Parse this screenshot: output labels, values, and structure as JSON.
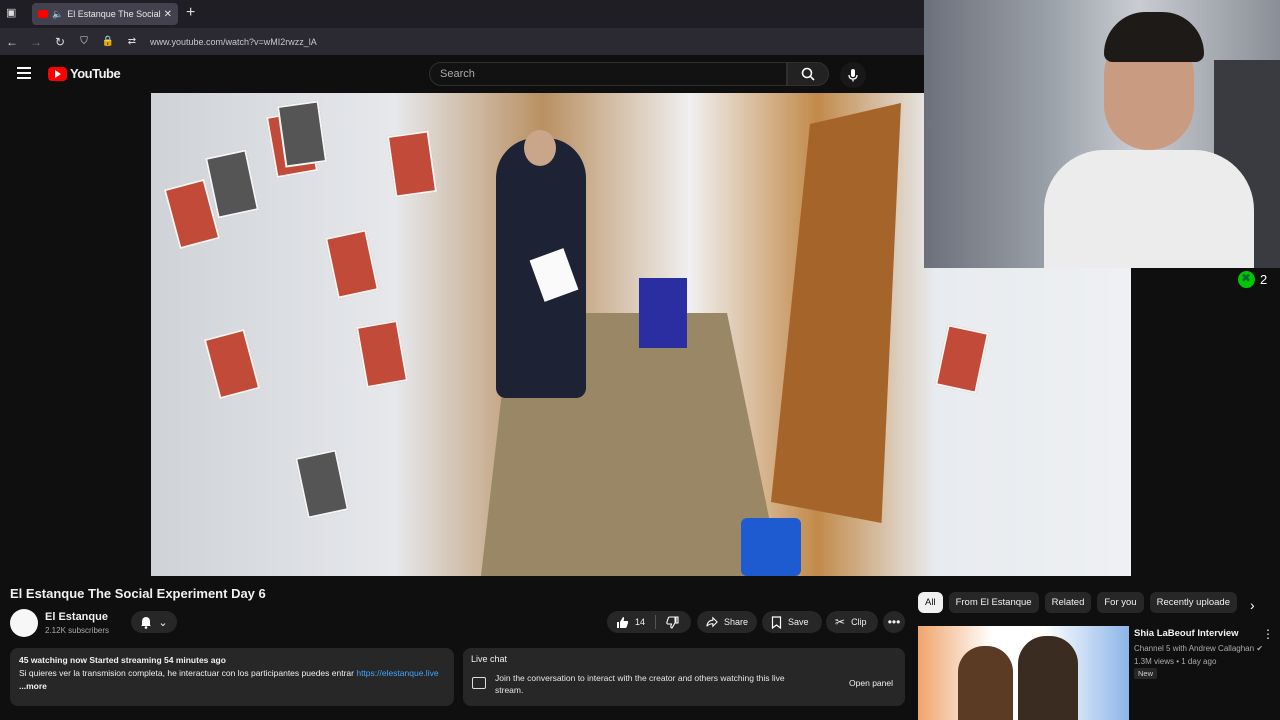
{
  "browser": {
    "tab_title": "El Estanque The Social Experi",
    "url": "www.youtube.com/watch?v=wMI2rwzz_lA"
  },
  "header": {
    "logo_text": "YouTube",
    "search_placeholder": "Search"
  },
  "stream": {
    "viewer_count": "2"
  },
  "video": {
    "title": "El Estanque The Social Experiment Day 6",
    "channel_name": "El Estanque",
    "subscribers": "2.12K subscribers",
    "likes": "14",
    "share_label": "Share",
    "save_label": "Save",
    "clip_label": "Clip"
  },
  "description": {
    "line1": "45 watching now  Started streaming 54 minutes ago",
    "line2": "Si quieres ver la transmision completa, he interactuar con los participantes puedes entrar ",
    "link": "https://elestanque.live",
    "more": " ...more"
  },
  "chat": {
    "header": "Live chat",
    "body": "Join the conversation to interact with the creator and others watching this live stream.",
    "open_label": "Open panel"
  },
  "chips": [
    "All",
    "From El Estanque",
    "Related",
    "For you",
    "Recently uploade"
  ],
  "related": {
    "title": "Shia LaBeouf Interview",
    "channel": "Channel 5 with Andrew Callaghan",
    "meta": "1.3M views • 1 day ago",
    "badge": "New"
  },
  "colors": {
    "accent": "#ff0000",
    "link": "#3ea6ff",
    "background": "#0f0f0f"
  }
}
